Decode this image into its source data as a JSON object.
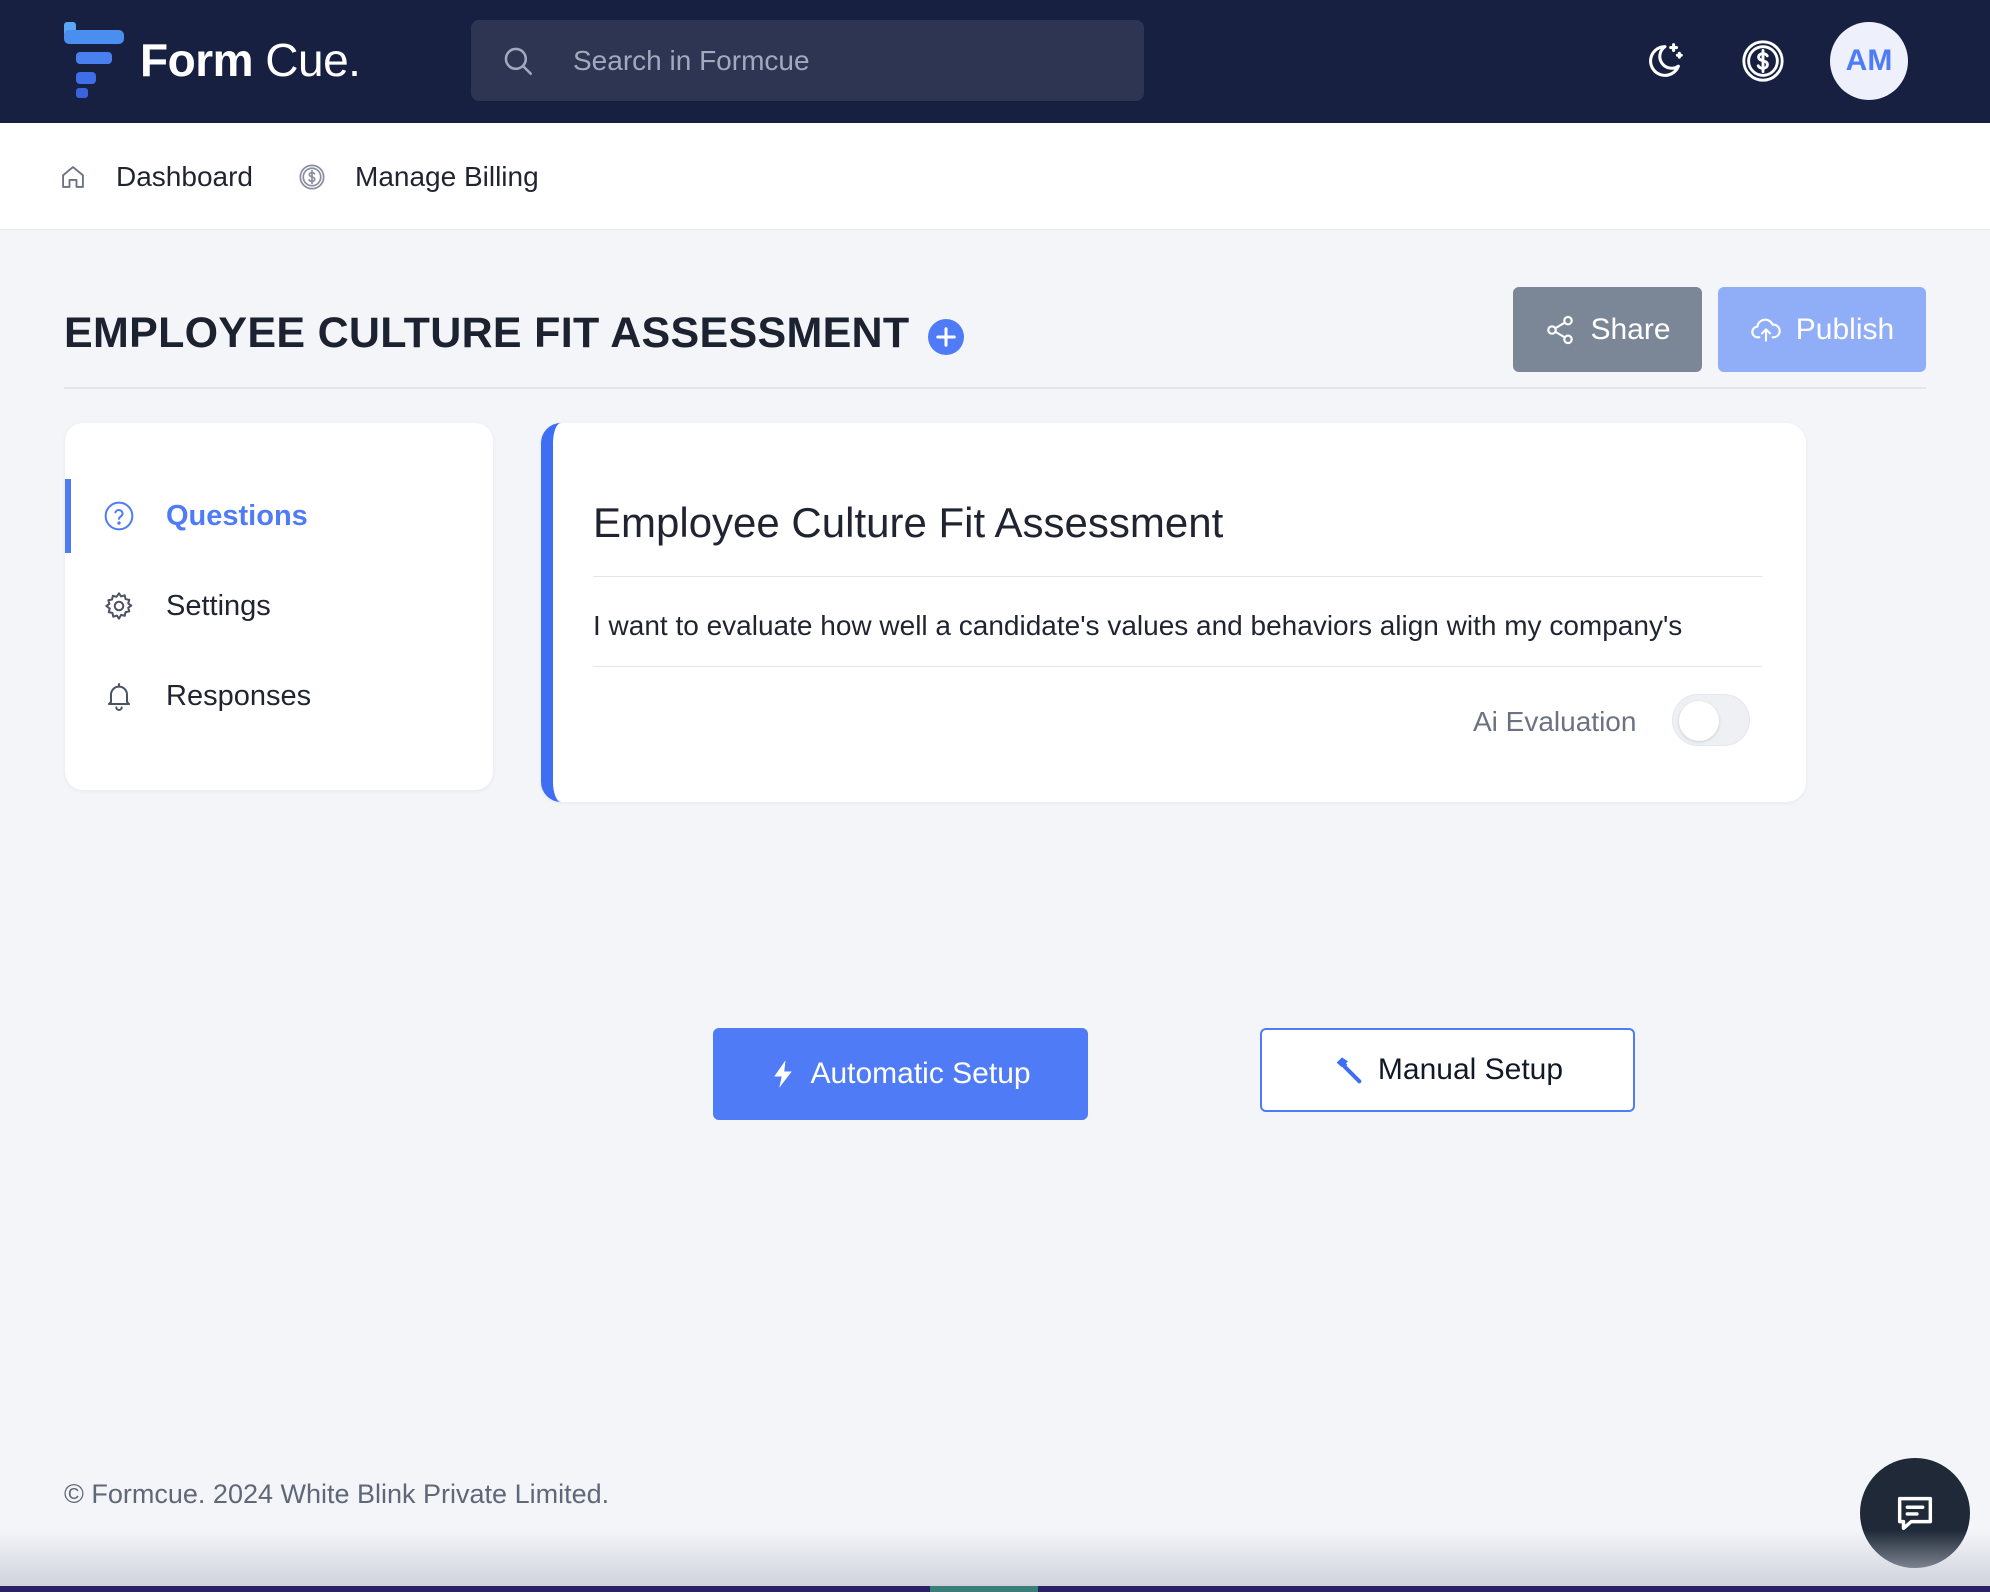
{
  "app": {
    "logo_bold": "Form",
    "logo_light": "Cue."
  },
  "search": {
    "placeholder": "Search in Formcue"
  },
  "header": {
    "icons": [
      "moon-stars-icon",
      "dollar-coin-icon"
    ],
    "avatar_initials": "AM"
  },
  "breadcrumb": {
    "items": [
      {
        "label": "Dashboard",
        "icon": "home-icon"
      },
      {
        "label": "Manage Billing",
        "icon": "dollar-coin-icon"
      }
    ]
  },
  "page": {
    "title": "EMPLOYEE CULTURE FIT ASSESSMENT",
    "share_label": "Share",
    "publish_label": "Publish"
  },
  "sidebar": {
    "items": [
      {
        "label": "Questions",
        "icon": "question-circle-icon",
        "active": true
      },
      {
        "label": "Settings",
        "icon": "gear-icon",
        "active": false
      },
      {
        "label": "Responses",
        "icon": "bell-icon",
        "active": false
      }
    ]
  },
  "form_card": {
    "title": "Employee Culture Fit Assessment",
    "description": "I want to evaluate how well a candidate's values and behaviors align with my company's",
    "ai_evaluation_label": "Ai Evaluation",
    "ai_evaluation_enabled": false
  },
  "setup": {
    "automatic_label": "Automatic Setup",
    "manual_label": "Manual Setup"
  },
  "footer": {
    "copyright": "© Formcue. 2024 White Blink Private Limited."
  },
  "colors": {
    "header_bg": "#172041",
    "accent": "#4f7cf6",
    "share_bg": "#7b8697",
    "publish_bg": "#90aef7",
    "page_bg": "#f4f5f9",
    "chat_bg": "#1f2937"
  }
}
